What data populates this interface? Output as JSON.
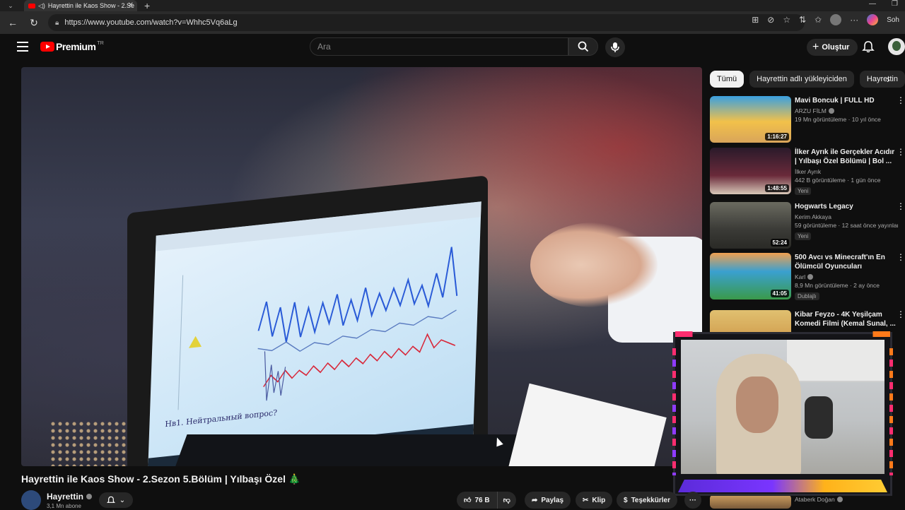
{
  "browser": {
    "tab_title": "Hayrettin ile Kaos Show - 2.Se",
    "url": "https://www.youtube.com/watch?v=Whhc5Vq6aLg",
    "sidebar_label": "Soh"
  },
  "header": {
    "brand": "Premium",
    "country": "TR",
    "search_placeholder": "Ara",
    "create_label": "Oluştur"
  },
  "video": {
    "title": "Hayrettin ile Kaos Show - 2.Sezon 5.Bölüm | Yılbaşı Özel 🎄",
    "screen_caption": "Нв1. Нейтральный вопрос?",
    "channel": "Hayrettin",
    "subscribers": "3,1 Mn abone",
    "likes": "76 B",
    "share_label": "Paylaş",
    "clip_label": "Klip",
    "thanks_label": "Teşekkürler"
  },
  "chips": [
    "Tümü",
    "Hayrettin adlı yükleyiciden",
    "Hayrettin"
  ],
  "recommendations": [
    {
      "title": "Mavi Boncuk | FULL HD",
      "channel": "ARZU FİLM",
      "verified": true,
      "meta": "19 Mn görüntüleme · 10 yıl önce",
      "duration": "1:16:27",
      "badge": "",
      "thumb_color": "#d9a55a"
    },
    {
      "title": "İlker Ayrık ile Gerçekler Acıdır | Yılbaşı Özel Bölümü | Bol ...",
      "channel": "İlker Ayrık",
      "verified": false,
      "meta": "442 B görüntüleme · 1 gün önce",
      "duration": "1:48:55",
      "badge": "Yeni",
      "thumb_color": "#5a2a3a"
    },
    {
      "title": "Hogwarts Legacy",
      "channel": "Kerim Akkaya",
      "verified": false,
      "meta": "59 görüntüleme · 12 saat önce yayınlandı",
      "duration": "52:24",
      "badge": "Yeni",
      "thumb_color": "#4a4a44"
    },
    {
      "title": "500 Avcı vs Minecraft'ın En Ölümcül Oyuncuları",
      "channel": "Karl",
      "verified": true,
      "meta": "8,9 Mn görüntüleme · 2 ay önce",
      "duration": "41:05",
      "badge": "Dublajlı",
      "thumb_color": "#3a9a4a"
    },
    {
      "title": "Kibar Feyzo - 4K Yeşilçam Komedi Filmi (Kemal Sunal, ...",
      "channel": "",
      "verified": false,
      "meta": "",
      "duration": "",
      "badge": "",
      "thumb_color": "#c98a3a"
    },
    {
      "title": "",
      "channel": "Ataberk Doğan",
      "verified": true,
      "meta": "",
      "duration": "",
      "badge": "",
      "thumb_color": "#7a5a3a"
    }
  ],
  "colors": {
    "brand_red": "#ff0000",
    "background": "#0f0f0f",
    "chip_bg": "#272727"
  }
}
